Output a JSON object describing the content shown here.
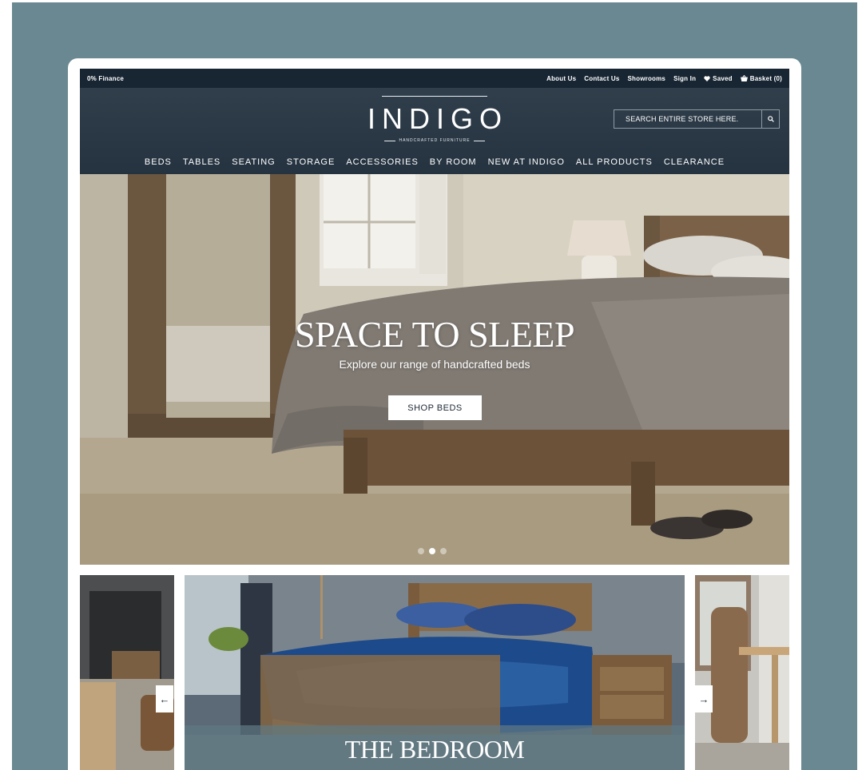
{
  "utility_bar": {
    "finance": "0% Finance",
    "links": [
      "About Us",
      "Contact Us",
      "Showrooms",
      "Sign In"
    ],
    "saved": "Saved",
    "basket": "Basket (0)"
  },
  "header": {
    "logo": "INDIGO",
    "tagline": "HANDCRAFTED FURNITURE",
    "search_placeholder": "SEARCH ENTIRE STORE HERE."
  },
  "nav": [
    "BEDS",
    "TABLES",
    "SEATING",
    "STORAGE",
    "ACCESSORIES",
    "BY ROOM",
    "NEW AT INDIGO",
    "ALL PRODUCTS",
    "CLEARANCE"
  ],
  "hero": {
    "title": "SPACE TO SLEEP",
    "subtitle": "Explore our range of handcrafted beds",
    "button": "SHOP BEDS",
    "dots": 3,
    "active_dot": 1
  },
  "carousel": {
    "center_caption": "THE BEDROOM",
    "prev_arrow": "←",
    "next_arrow": "→"
  },
  "colors": {
    "backdrop": "#6a8891",
    "header": "#1e2c3a",
    "utility": "#182633"
  }
}
